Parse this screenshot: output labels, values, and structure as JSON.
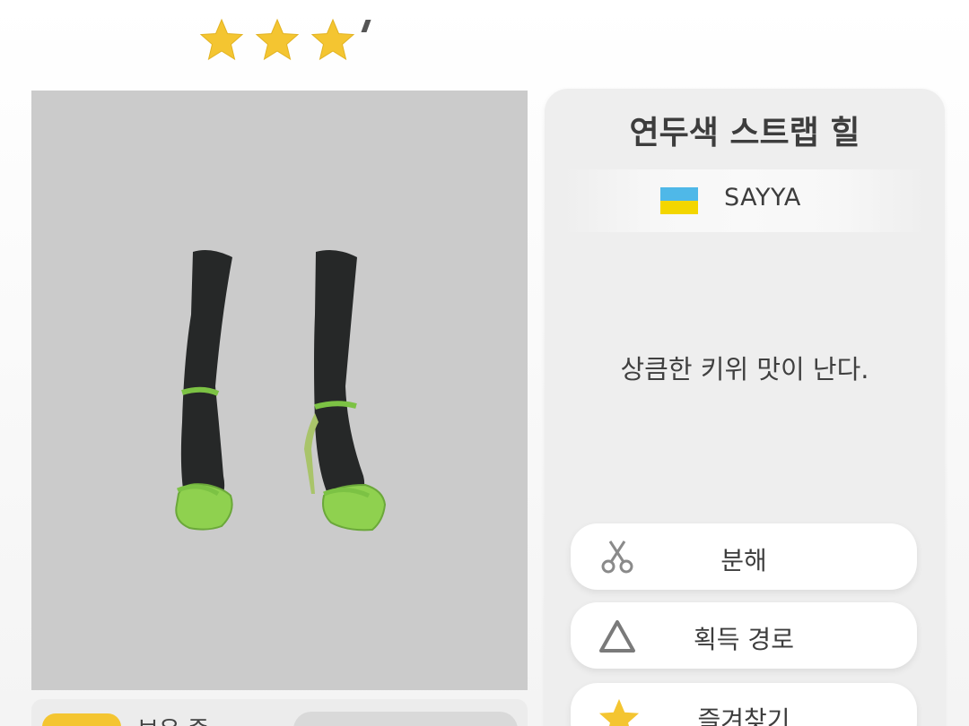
{
  "rating": {
    "stars": 3,
    "max": 3,
    "color": "#f4c531"
  },
  "item": {
    "name": "연두색 스트랩 힐",
    "brand": "SAYYA",
    "brand_flag": "ukraine-flag",
    "description": "상큼한 키위 맛이 난다."
  },
  "actions": {
    "dismantle_label": "분해",
    "route_label": "획득 경로",
    "favorite_label": "즐겨찾기"
  },
  "owned": {
    "label": "보유 중"
  },
  "colors": {
    "preview_bg": "#cbcbcb",
    "shoe_green": "#8fd14f",
    "accent_yellow": "#f4c531"
  }
}
